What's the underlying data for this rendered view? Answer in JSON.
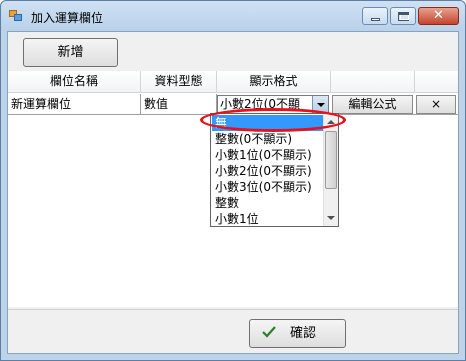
{
  "window": {
    "title": "加入運算欄位"
  },
  "toolbar": {
    "add_label": "新增"
  },
  "grid": {
    "columns": [
      "欄位名稱",
      "資料型態",
      "顯示格式"
    ],
    "rows": [
      {
        "name": "新運算欄位",
        "type": "數值",
        "format": "小數2位(0不顯",
        "edit_label": "編輯公式",
        "delete_label": "×"
      }
    ]
  },
  "dropdown": {
    "options": [
      "無",
      "整數(0不顯示)",
      "小數1位(0不顯示)",
      "小數2位(0不顯示)",
      "小數3位(0不顯示)",
      "整數",
      "小數1位"
    ],
    "selected_index": 0
  },
  "footer": {
    "ok_label": "確認"
  },
  "colors": {
    "highlight": "#e8101a",
    "selection": "#3399ff",
    "check": "#2a7f2a"
  }
}
